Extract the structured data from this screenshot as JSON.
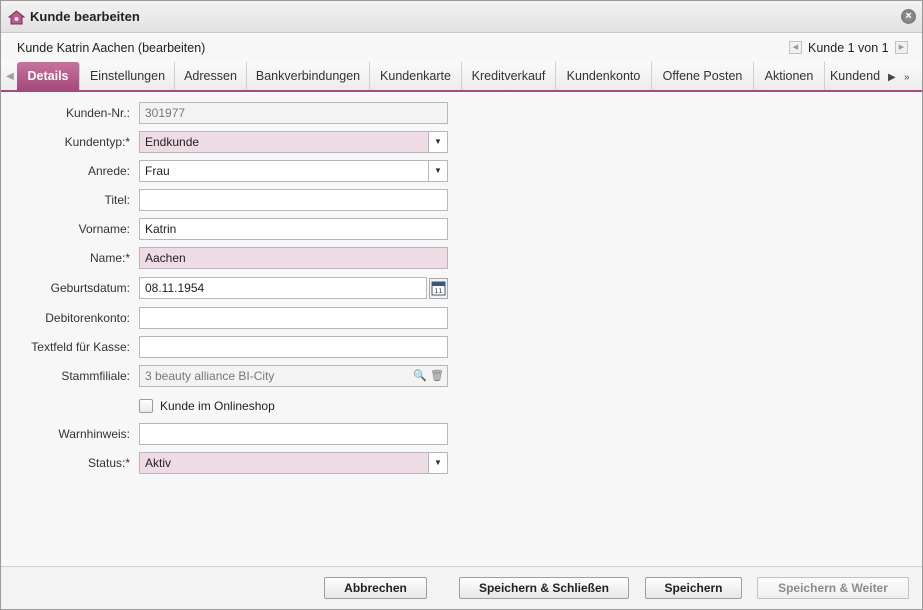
{
  "window": {
    "title": "Kunde bearbeiten",
    "close_icon": "close-icon"
  },
  "header": {
    "record_title": "Kunde Katrin Aachen (bearbeiten)",
    "pager_text": "Kunde 1 von 1"
  },
  "tabs": [
    {
      "label": "Details",
      "active": true
    },
    {
      "label": "Einstellungen",
      "active": false
    },
    {
      "label": "Adressen",
      "active": false
    },
    {
      "label": "Bankverbindungen",
      "active": false
    },
    {
      "label": "Kundenkarte",
      "active": false
    },
    {
      "label": "Kreditverkauf",
      "active": false
    },
    {
      "label": "Kundenkonto",
      "active": false
    },
    {
      "label": "Offene Posten",
      "active": false
    },
    {
      "label": "Aktionen",
      "active": false
    },
    {
      "label": "Kundend",
      "active": false
    }
  ],
  "form": {
    "customer_number": {
      "label": "Kunden-Nr.:",
      "value": "301977"
    },
    "customer_type": {
      "label": "Kundentyp:*",
      "value": "Endkunde"
    },
    "salutation": {
      "label": "Anrede:",
      "value": "Frau"
    },
    "title": {
      "label": "Titel:",
      "value": ""
    },
    "first_name": {
      "label": "Vorname:",
      "value": "Katrin"
    },
    "last_name": {
      "label": "Name:*",
      "value": "Aachen"
    },
    "birth_date": {
      "label": "Geburtsdatum:",
      "value": "08.11.1954"
    },
    "debtor_account": {
      "label": "Debitorenkonto:",
      "value": ""
    },
    "cash_text": {
      "label": "Textfeld für Kasse:",
      "value": ""
    },
    "home_branch": {
      "label": "Stammfiliale:",
      "value": "3 beauty alliance BI-City"
    },
    "online_shop": {
      "label": "Kunde im Onlineshop",
      "checked": false
    },
    "warning": {
      "label": "Warnhinweis:",
      "value": ""
    },
    "status": {
      "label": "Status:*",
      "value": "Aktiv"
    }
  },
  "footer": {
    "cancel_label": "Abbrechen",
    "save_close_label": "Speichern & Schließen",
    "save_label": "Speichern",
    "save_next_label": "Speichern & Weiter"
  },
  "colors": {
    "accent": "#a44a7c",
    "required_field": "#efdbe5"
  }
}
